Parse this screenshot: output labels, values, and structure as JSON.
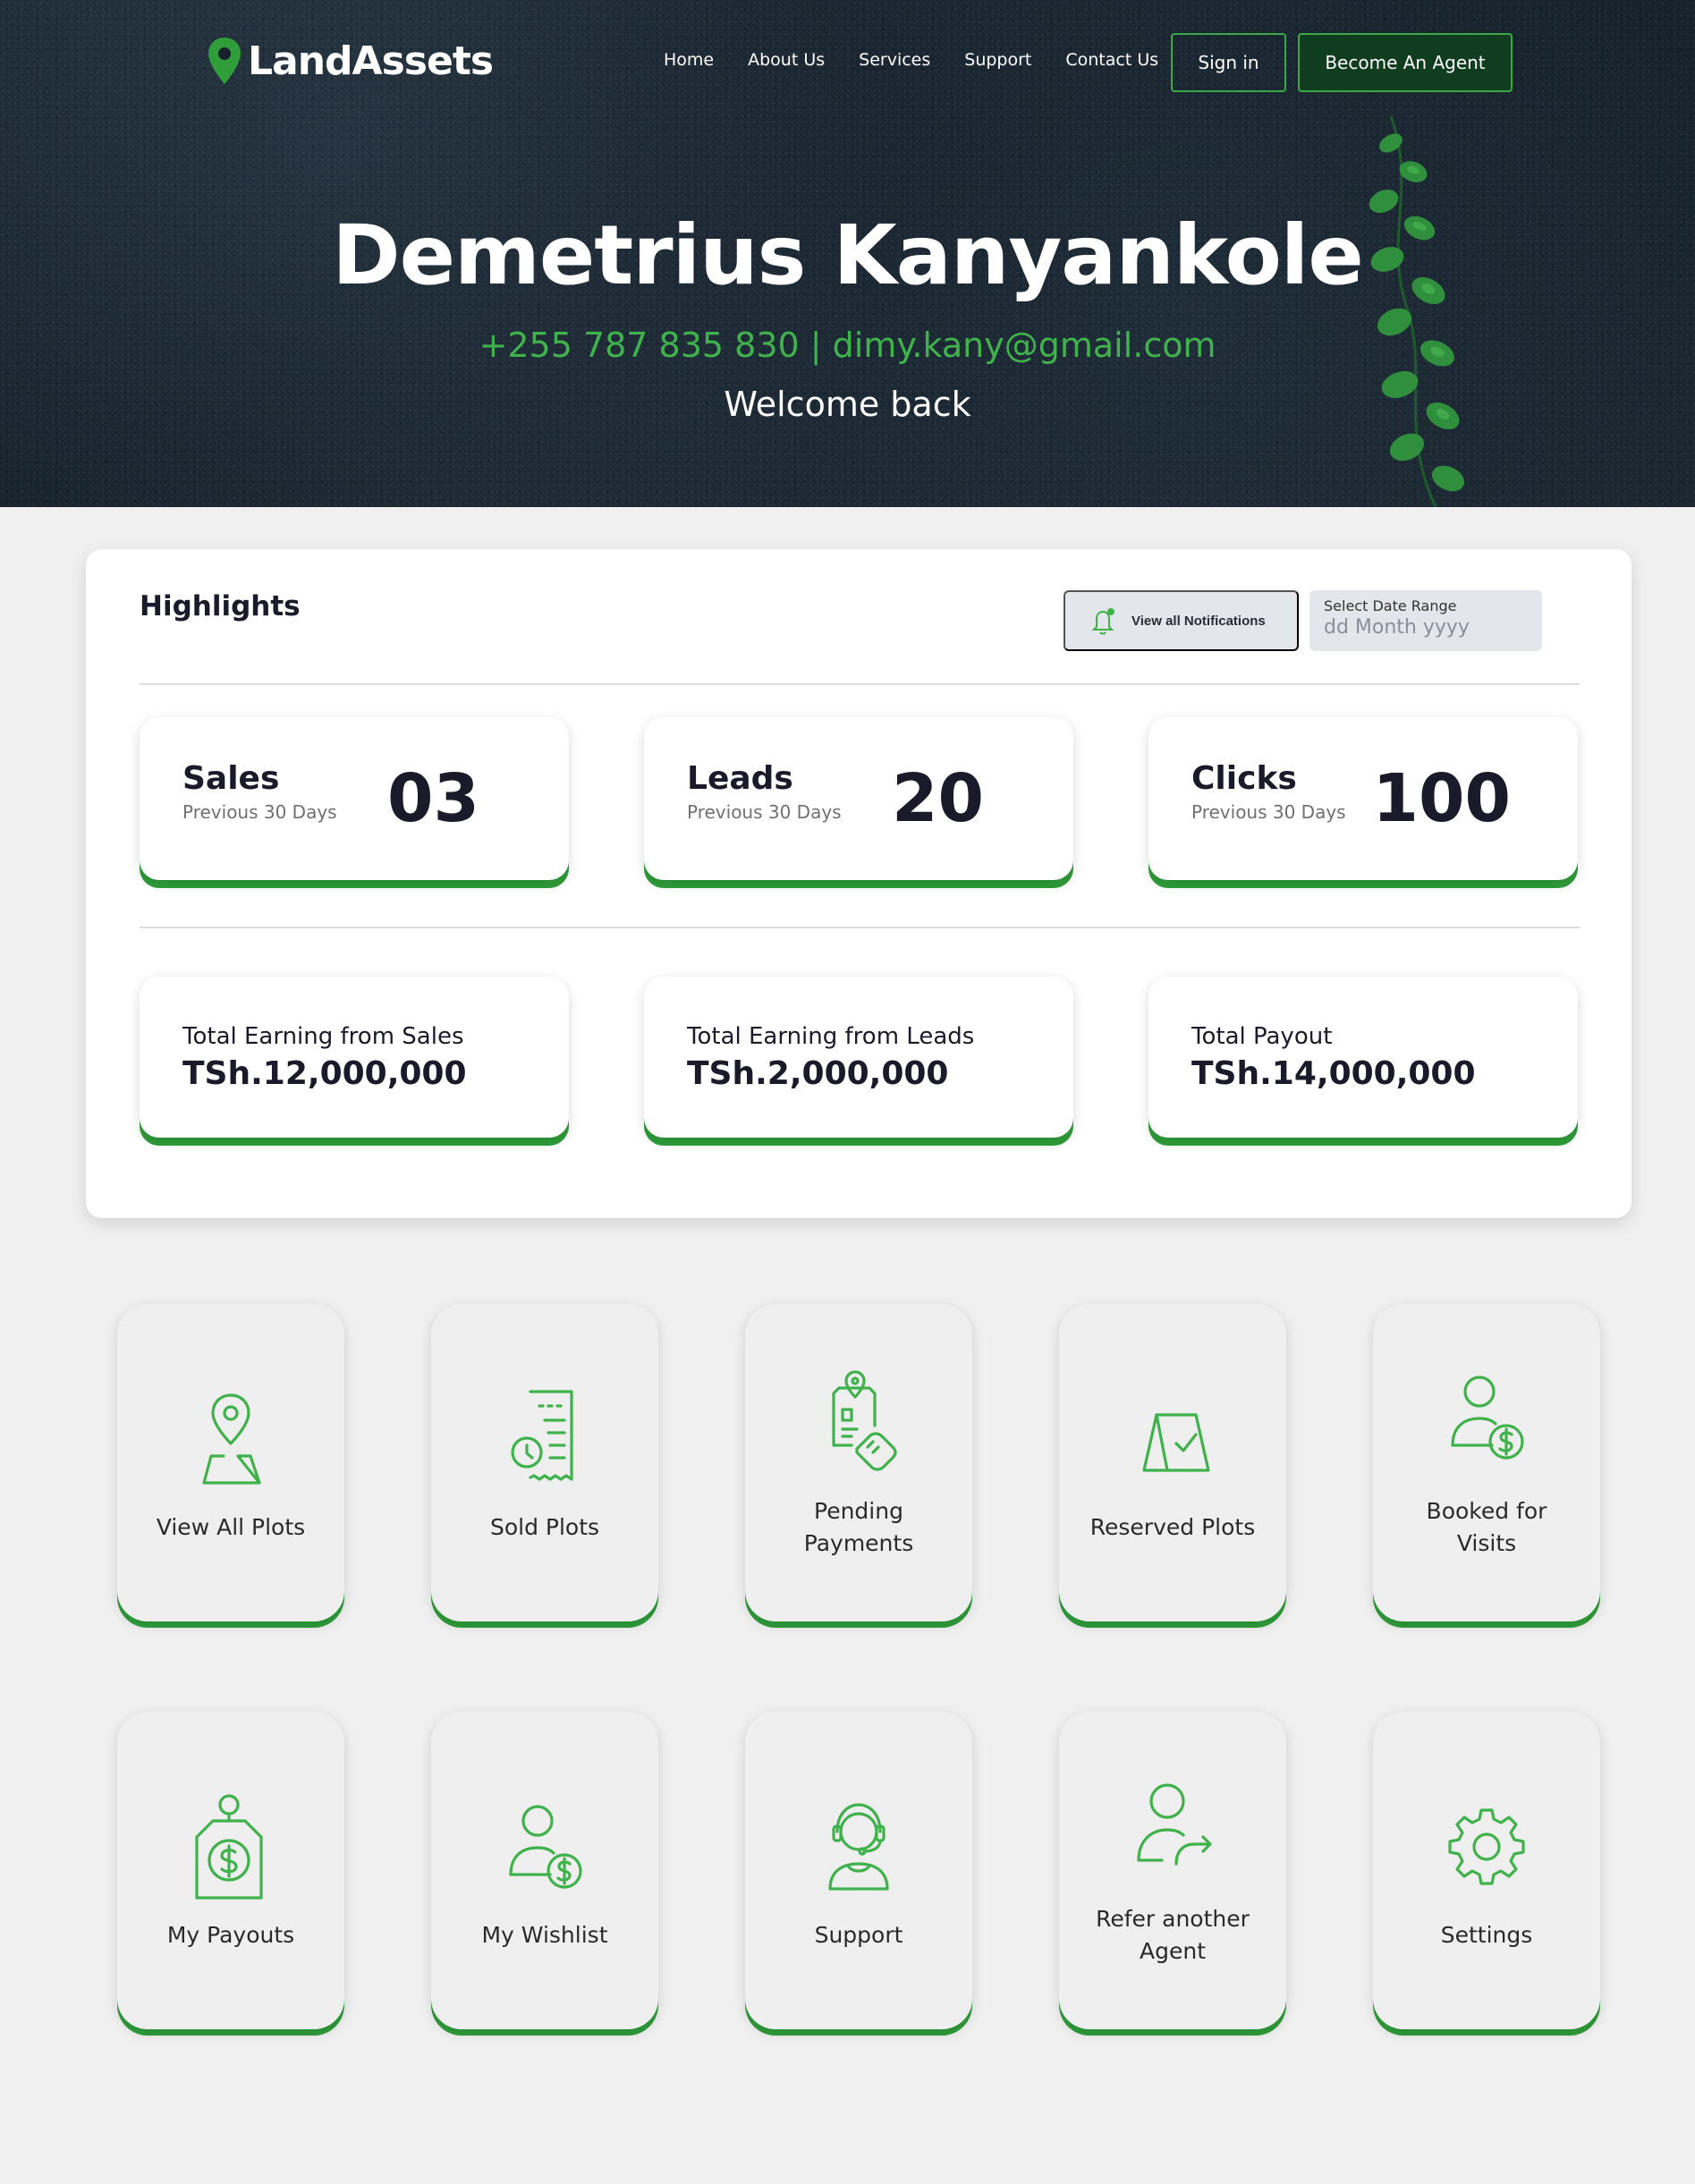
{
  "brand": {
    "name": "LandAssets",
    "accent": "#3fb24b",
    "dark_green": "#103c1f"
  },
  "nav": {
    "items": [
      "Home",
      "About Us",
      "Services",
      "Support",
      "Contact Us"
    ],
    "sign_in": "Sign in",
    "become_agent": "Become An Agent"
  },
  "hero": {
    "name": "Demetrius Kanyankole",
    "contact": "+255 787 835 830 | dimy.kany@gmail.com",
    "greeting": "Welcome back"
  },
  "highlights": {
    "title": "Highlights",
    "notifications_label": "View all Notifications",
    "date_range_label": "Select Date Range",
    "date_range_placeholder": "dd Month yyyy",
    "stats": [
      {
        "label": "Sales",
        "sub": "Previous 30 Days",
        "value": "03"
      },
      {
        "label": "Leads",
        "sub": "Previous 30 Days",
        "value": "20"
      },
      {
        "label": "Clicks",
        "sub": "Previous 30 Days",
        "value": "100"
      }
    ],
    "earnings": [
      {
        "label": "Total Earning from Sales",
        "value": "TSh.12,000,000"
      },
      {
        "label": "Total Earning from Leads",
        "value": "TSh.2,000,000"
      },
      {
        "label": "Total Payout",
        "value": "TSh.14,000,000"
      }
    ]
  },
  "tiles": [
    {
      "label": "View All Plots",
      "icon": "map-pin-icon"
    },
    {
      "label": "Sold Plots",
      "icon": "receipt-clock-icon"
    },
    {
      "label": "Pending Payments",
      "icon": "hand-card-icon"
    },
    {
      "label": "Reserved Plots",
      "icon": "bag-check-icon"
    },
    {
      "label": "Booked for Visits",
      "icon": "user-dollar-icon"
    },
    {
      "label": "My Payouts",
      "icon": "price-tag-dollar-icon"
    },
    {
      "label": "My Wishlist",
      "icon": "user-dollar-icon"
    },
    {
      "label": "Support",
      "icon": "headset-agent-icon"
    },
    {
      "label": "Refer another Agent",
      "icon": "user-share-icon"
    },
    {
      "label": "Settings",
      "icon": "gear-icon"
    }
  ]
}
